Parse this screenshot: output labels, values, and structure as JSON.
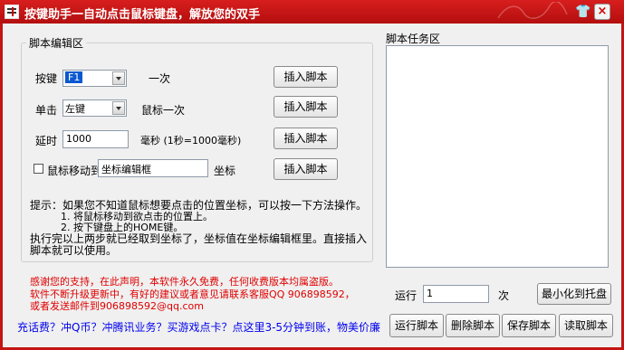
{
  "window": {
    "title": "按键助手一自动点击鼠标键盘，解放您的双手",
    "close_symbol": "×"
  },
  "editor": {
    "group_title": "脚本编辑区",
    "key_row": {
      "label": "按键",
      "value": "F1",
      "suffix": "一次",
      "button": "插入脚本"
    },
    "click_row": {
      "label": "单击",
      "value": "左键",
      "suffix": "鼠标一次",
      "button": "插入脚本"
    },
    "delay_row": {
      "label": "延时",
      "value": "1000",
      "suffix": "毫秒 (1秒=1000毫秒)",
      "button": "插入脚本"
    },
    "move_row": {
      "label": "鼠标移动到",
      "value": "坐标编辑框",
      "suffix": "坐标",
      "button": "插入脚本"
    },
    "hint_lines": [
      "提示：如果您不知道鼠标想要点击的位置坐标，可以按一下方法操作。",
      "1. 将鼠标移动到欲点击的位置上。",
      "2. 按下键盘上的HOME键。",
      "执行完以上两步就已经取到坐标了，坐标值在坐标编辑框里。直接插入",
      "脚本就可以使用。"
    ]
  },
  "task": {
    "title": "脚本任务区"
  },
  "notice_lines": [
    "感谢您的支持，在此声明，本软件永久免费，任何收费版本均属盗版。",
    "软件不断升级更新中，有好的建议或者意见请联系客服QQ 906898592，",
    "或者发送邮件到906898592@qq.com"
  ],
  "run": {
    "label": "运行",
    "count": "1",
    "unit": "次",
    "minimize_button": "最小化到托盘"
  },
  "actions": {
    "run": "运行脚本",
    "delete": "删除脚本",
    "save": "保存脚本",
    "load": "读取脚本"
  },
  "promo_link": "充话费？冲Q币？冲腾讯业务？买游戏点卡？点这里3-5分钟到账，物美价廉",
  "colors": {
    "title_bar": "#c41414",
    "notice": "#e00000",
    "link": "#0000ee"
  },
  "icons": [
    "app-icon",
    "skin-icon",
    "close-icon",
    "checkbox-icon"
  ]
}
